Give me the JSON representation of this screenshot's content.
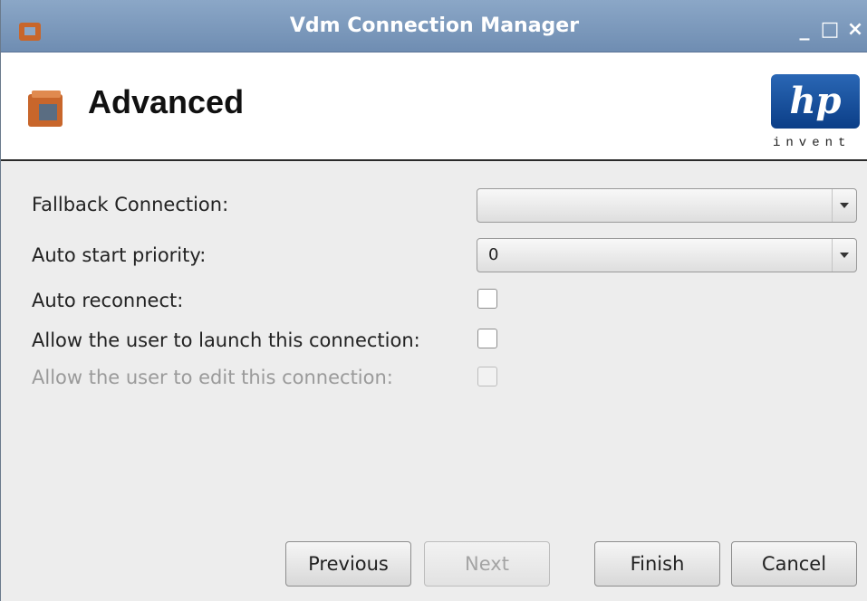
{
  "window": {
    "title": "Vdm Connection Manager",
    "controls": {
      "minimize": "_",
      "maximize": "□",
      "close": "×"
    }
  },
  "header": {
    "title": "Advanced",
    "logo": {
      "text": "hp",
      "tagline": "invent"
    }
  },
  "form": {
    "fallback_connection": {
      "label": "Fallback Connection:",
      "value": ""
    },
    "auto_start_priority": {
      "label": "Auto start priority:",
      "value": "0"
    },
    "auto_reconnect": {
      "label": "Auto reconnect:",
      "checked": false
    },
    "allow_launch": {
      "label": "Allow the user to launch this connection:",
      "checked": false
    },
    "allow_edit": {
      "label": "Allow the user to edit this connection:",
      "checked": false,
      "disabled": true
    }
  },
  "buttons": {
    "previous": "Previous",
    "next": "Next",
    "finish": "Finish",
    "cancel": "Cancel"
  },
  "colors": {
    "titlebar": "#7b98bc",
    "hp_blue": "#1c56a5",
    "icon_orange": "#c8662b"
  },
  "icons": {
    "app": "vmware-view-icon",
    "combo_arrow": "triangle-down-icon"
  }
}
